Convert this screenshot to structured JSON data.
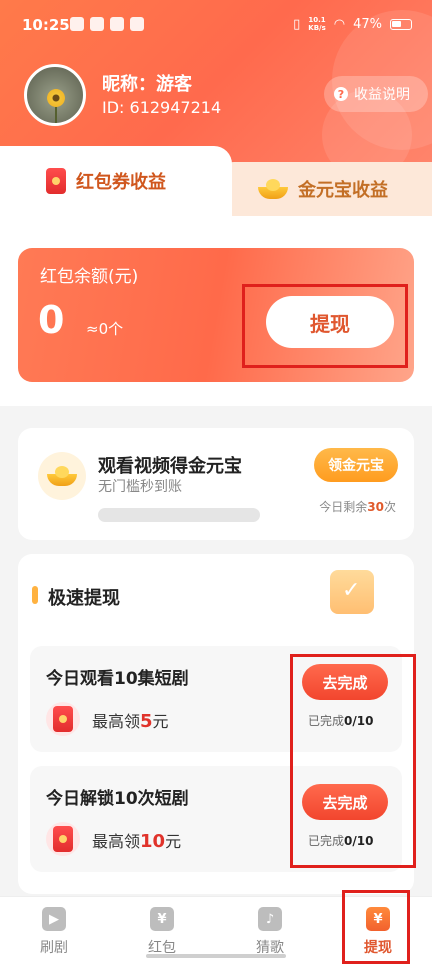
{
  "status_bar": {
    "time": "10:25",
    "net_speed_top": "10.1",
    "net_speed_bottom": "KB/s",
    "battery": "47%"
  },
  "profile": {
    "nickname": "昵称：游客",
    "id": "ID: 612947214"
  },
  "help_button": "收益说明",
  "tabs": [
    {
      "label": "红包券收益"
    },
    {
      "label": "金元宝收益"
    }
  ],
  "balance": {
    "label": "红包余额(元)",
    "amount": "0",
    "coins": "≈0个",
    "withdraw_label": "提现"
  },
  "video_task": {
    "title": "观看视频得金元宝",
    "subtitle": "无门槛秒到账",
    "button": "领金元宝",
    "remain_prefix": "今日剩余",
    "remain_count": "30",
    "remain_suffix": "次"
  },
  "fast_withdraw": {
    "title": "极速提现",
    "tasks": [
      {
        "title": "今日观看10集短剧",
        "reward_prefix": "最高领",
        "reward_amount": "5",
        "reward_unit": "元",
        "button": "去完成",
        "progress_prefix": "已完成",
        "progress": "0/10"
      },
      {
        "title": "今日解锁10次短剧",
        "reward_prefix": "最高领",
        "reward_amount": "10",
        "reward_unit": "元",
        "button": "去完成",
        "progress_prefix": "已完成",
        "progress": "0/10"
      }
    ]
  },
  "bottom_nav": [
    {
      "label": "刷剧",
      "icon": "video-icon"
    },
    {
      "label": "红包",
      "icon": "red-packet-icon"
    },
    {
      "label": "猜歌",
      "icon": "music-icon"
    },
    {
      "label": "提现",
      "icon": "money-bag-icon",
      "active": true
    }
  ]
}
